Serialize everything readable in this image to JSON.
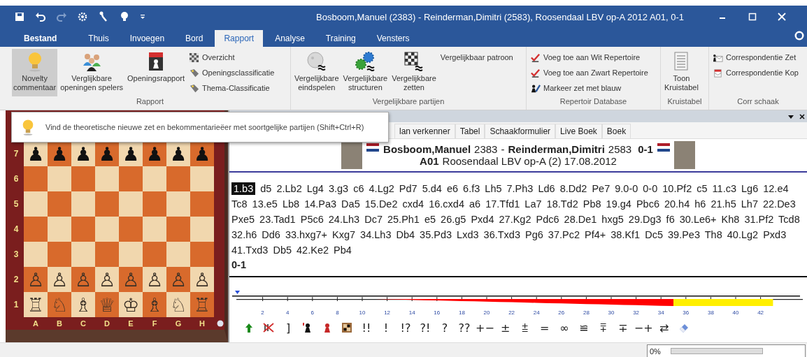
{
  "window": {
    "title": "Bosboom,Manuel (2383) - Reinderman,Dimitri (2583), Roosendaal LBV op-A 2012  A01, 0-1"
  },
  "ribbon_tabs": [
    {
      "label": "Bestand",
      "selected": false
    },
    {
      "label": "Thuis",
      "selected": false
    },
    {
      "label": "Invoegen",
      "selected": false
    },
    {
      "label": "Bord",
      "selected": false
    },
    {
      "label": "Rapport",
      "selected": true
    },
    {
      "label": "Analyse",
      "selected": false
    },
    {
      "label": "Training",
      "selected": false
    },
    {
      "label": "Vensters",
      "selected": false
    }
  ],
  "ribbon_groups": [
    {
      "label": "Rapport",
      "buttons": [
        {
          "kind": "large",
          "label": "Novelty\ncommentaar",
          "highlighted": true
        },
        {
          "kind": "large",
          "label": "Verglijkbare\nopeningen spelers",
          "highlighted": false
        },
        {
          "kind": "large",
          "label": "Openingsrapport\n ",
          "highlighted": false
        },
        {
          "kind": "small",
          "label": "Overzicht",
          "highlighted": false
        },
        {
          "kind": "small",
          "label": "Openingsclassificatie",
          "highlighted": false
        },
        {
          "kind": "small",
          "label": "Thema-Classificatie",
          "highlighted": false
        }
      ]
    },
    {
      "label": "Vergelijkbare partijen",
      "buttons": [
        {
          "kind": "large",
          "label": "Vergelijkbare\neindspelen",
          "highlighted": false
        },
        {
          "kind": "large",
          "label": "Vergelijkbare\nstructuren",
          "highlighted": false
        },
        {
          "kind": "large",
          "label": "Vergelijkbare\nzetten",
          "highlighted": false
        },
        {
          "kind": "small",
          "label": "Vergelijkbaar patroon",
          "highlighted": false
        }
      ]
    },
    {
      "label": "Repertoir Database",
      "buttons": [
        {
          "kind": "small",
          "label": "Voeg toe aan Wit Repertoire",
          "highlighted": false
        },
        {
          "kind": "small",
          "label": "Voeg toe aan Zwart Repertoire",
          "highlighted": false
        },
        {
          "kind": "small",
          "label": "Markeer zet met blauw",
          "highlighted": false
        }
      ]
    },
    {
      "label": "Kruistabel",
      "buttons": [
        {
          "kind": "large",
          "label": "Toon\nKruistabel",
          "highlighted": false
        }
      ]
    },
    {
      "label": "Corr schaak",
      "buttons": [
        {
          "kind": "small",
          "label": "Correspondentie Zet",
          "highlighted": false
        },
        {
          "kind": "small",
          "label": "Correspondentie Kop",
          "highlighted": false
        }
      ]
    }
  ],
  "tooltip": {
    "text": "Vind de theoretische nieuwe zet en bekommentarieëer met soortgelijke partijen (Shift+Ctrl+R)"
  },
  "board": {
    "ranks": [
      {
        "label": "7",
        "squares": [
          {
            "glyph": "♟",
            "white": false
          },
          {
            "glyph": "♟",
            "white": false
          },
          {
            "glyph": "♟",
            "white": false
          },
          {
            "glyph": "♟",
            "white": false
          },
          {
            "glyph": "♟",
            "white": false
          },
          {
            "glyph": "♟",
            "white": false
          },
          {
            "glyph": "♟",
            "white": false
          },
          {
            "glyph": "♟",
            "white": false
          }
        ]
      },
      {
        "label": "6"
      },
      {
        "label": "5"
      },
      {
        "label": "4"
      },
      {
        "label": "3"
      },
      {
        "label": "2",
        "squares": [
          {
            "glyph": "♙",
            "white": true
          },
          {
            "glyph": "♙",
            "white": true
          },
          {
            "glyph": "♙",
            "white": true
          },
          {
            "glyph": "♙",
            "white": true
          },
          {
            "glyph": "♙",
            "white": true
          },
          {
            "glyph": "♙",
            "white": true
          },
          {
            "glyph": "♙",
            "white": true
          },
          {
            "glyph": "♙",
            "white": true
          }
        ]
      },
      {
        "label": "1",
        "squares": [
          {
            "glyph": "♖",
            "white": true
          },
          {
            "glyph": "♘",
            "white": true
          },
          {
            "glyph": "♗",
            "white": true
          },
          {
            "glyph": "♕",
            "white": true
          },
          {
            "glyph": "♔",
            "white": true
          },
          {
            "glyph": "♗",
            "white": true
          },
          {
            "glyph": "♘",
            "white": true
          },
          {
            "glyph": "♖",
            "white": true
          }
        ]
      }
    ],
    "files": [
      "A",
      "B",
      "C",
      "D",
      "E",
      "F",
      "G",
      "H"
    ]
  },
  "notation_tabs": [
    {
      "label": "lan verkenner",
      "selected": false
    },
    {
      "label": "Tabel",
      "selected": false
    },
    {
      "label": "Schaakformulier",
      "selected": false
    },
    {
      "label": "Live Boek",
      "selected": false
    },
    {
      "label": "Boek",
      "selected": false
    }
  ],
  "game_header": {
    "white": {
      "name": "Bosboom,Manuel",
      "rating": "2383"
    },
    "separator": "-",
    "black": {
      "name": "Reinderman,Dimitri",
      "rating": "2583"
    },
    "result": "0-1",
    "eco": "A01",
    "event": "Roosendaal LBV op-A (2) 17.08.2012"
  },
  "notation": {
    "current_move": "1.b3",
    "moves": "d5 2.Lb2 Lg4 3.g3 c6 4.Lg2 Pd7 5.d4 e6 6.f3 Lh5 7.Ph3 Ld6 8.Dd2 Pe7 9.0-0 0-0 10.Pf2 c5 11.c3 Lg6 12.e4 Tc8 13.e5 Lb8 14.Pa3 Da5 15.De2 cxd4 16.cxd4 a6 17.Tfd1 La7 18.Td2 Pb8 19.g4 Pbc6 20.h4 h6 21.h5 Lh7 22.De3 Pxe5 23.Tad1 P5c6 24.Lh3 Dc7 25.Ph1 e5 26.g5 Pxd4 27.Kg2 Pdc6 28.De1 hxg5 29.Dg3 f6 30.Le6+ Kh8 31.Pf2 Tcd8 32.h6 Dd6 33.hxg7+ Kxg7 34.Lh3 Db4 35.Pd3 Lxd3 36.Txd3 Pg6 37.Pc2 Pf4+ 38.Kf1 Dc5 39.Pe3 Th8 40.Lg2 Pxd3 41.Txd3 Db5 42.Ke2 Pb4",
    "result": "0-1"
  },
  "graph_ticks": [
    "2",
    "4",
    "6",
    "8",
    "10",
    "12",
    "14",
    "16",
    "18",
    "20",
    "22",
    "24",
    "26",
    "28",
    "30",
    "32",
    "34",
    "36",
    "38",
    "40",
    "42"
  ],
  "annotation_symbols": [
    "]",
    "!!",
    "!",
    "!?",
    "?!",
    "?",
    "??",
    "+−",
    "±",
    "⩲",
    "=",
    "∞",
    "≌",
    "⩱",
    "∓",
    "−+",
    "⇄"
  ],
  "status_bar": {
    "progress": {
      "label": "0%",
      "level": 0
    }
  }
}
